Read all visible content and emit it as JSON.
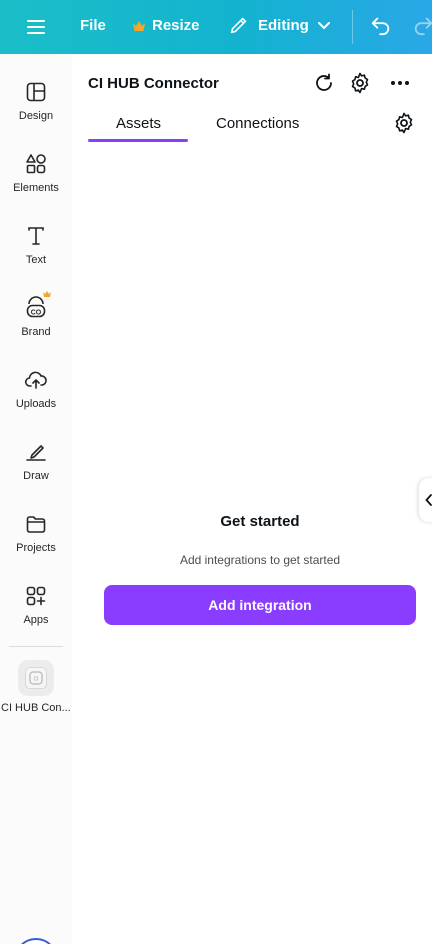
{
  "topbar": {
    "file_label": "File",
    "resize_label": "Resize",
    "editing_label": "Editing"
  },
  "rail": {
    "items": [
      {
        "label": "Design",
        "icon": "layout-icon"
      },
      {
        "label": "Elements",
        "icon": "shapes-icon"
      },
      {
        "label": "Text",
        "icon": "text-icon"
      },
      {
        "label": "Brand",
        "icon": "brand-icon"
      },
      {
        "label": "Uploads",
        "icon": "cloud-upload-icon"
      },
      {
        "label": "Draw",
        "icon": "pen-icon"
      },
      {
        "label": "Projects",
        "icon": "folder-icon"
      },
      {
        "label": "Apps",
        "icon": "apps-icon"
      }
    ],
    "app": {
      "label": "CI HUB Con..."
    }
  },
  "panel": {
    "title": "CI HUB Connector",
    "tabs": [
      {
        "label": "Assets",
        "active": true
      },
      {
        "label": "Connections",
        "active": false
      }
    ],
    "empty": {
      "title": "Get started",
      "subtitle": "Add integrations to get started",
      "button_label": "Add integration"
    }
  },
  "colors": {
    "topbar_start": "#1bbec8",
    "topbar_end": "#2aa7e6",
    "accent": "#8b3dff",
    "crown": "#f4a62a"
  }
}
